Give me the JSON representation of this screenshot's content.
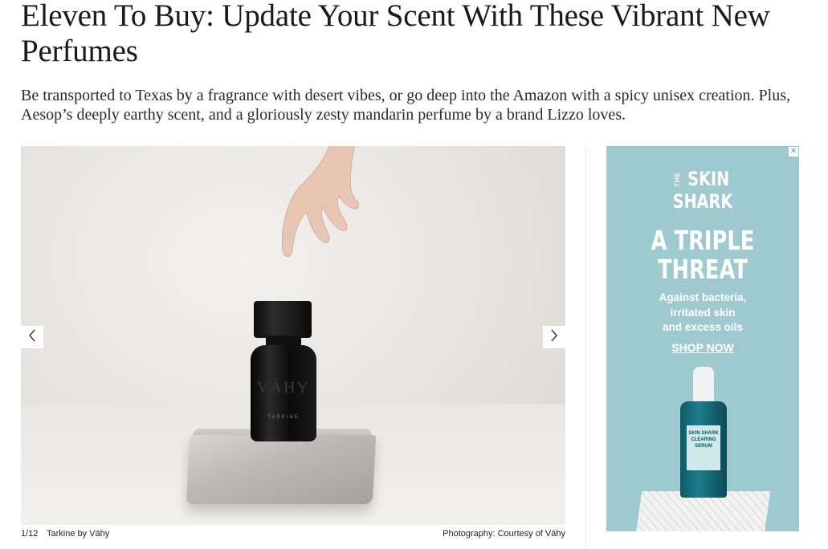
{
  "article": {
    "headline": "Eleven To Buy: Update Your Scent With These Vibrant New Perfumes",
    "dek": "Be transported to Texas by a fragrance with desert vibes, or go deep into the Amazon with a spicy unisex creation. Plus, Aesop’s deeply earthy scent, and a gloriously zesty mandarin perfume by a brand Lizzo loves."
  },
  "gallery": {
    "counter": "1/12",
    "caption": "Tarkine by Váhy",
    "credit": "Photography: Courtesy of Váhy",
    "prev_icon": "chevron-left-icon",
    "next_icon": "chevron-right-icon",
    "bottle_brand": "VÁHY",
    "bottle_name": "TARKINE"
  },
  "ad": {
    "logo_small": "THE",
    "logo_line1": "SKIN",
    "logo_line2": "SHARK",
    "headline_line1": "A TRIPLE",
    "headline_line2": "THREAT",
    "body_line1": "Against bacteria,",
    "body_line2": "irritated skin",
    "body_line3": "and excess oils",
    "cta": "SHOP NOW",
    "close_icon": "close-icon",
    "product_brand": "SKIN SHARK",
    "product_name": "CLEARING SERUM",
    "background_color": "#9dc9cf"
  }
}
